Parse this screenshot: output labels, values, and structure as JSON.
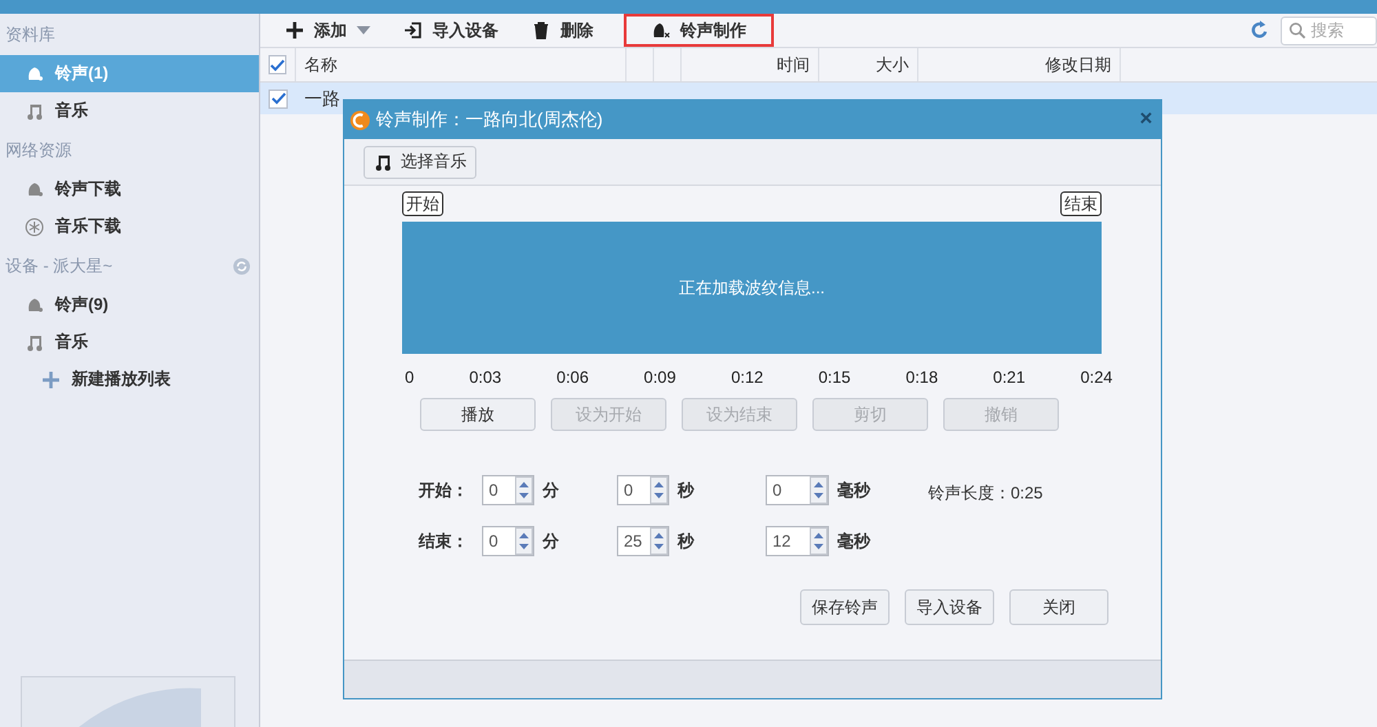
{
  "sidebar": {
    "sections": [
      {
        "title": "资料库",
        "kind": "library",
        "items": [
          {
            "label": "铃声(1)",
            "kind": "bell",
            "selected": true
          },
          {
            "label": "音乐",
            "kind": "note",
            "selected": false
          }
        ]
      },
      {
        "title": "网络资源",
        "kind": "library",
        "items": [
          {
            "label": "铃声下载",
            "kind": "bell",
            "selected": false
          },
          {
            "label": "音乐下载",
            "kind": "asterisk",
            "selected": false
          }
        ]
      },
      {
        "title": "设备 - 派大星~",
        "kind": "device",
        "items": [
          {
            "label": "铃声(9)",
            "kind": "bell",
            "selected": false
          },
          {
            "label": "音乐",
            "kind": "note",
            "selected": false
          },
          {
            "label": "新建播放列表",
            "kind": "plus",
            "selected": false
          }
        ]
      }
    ]
  },
  "toolbar": {
    "buttons": [
      {
        "label": "添加",
        "kind": "plus",
        "dropdown": true,
        "highlighted": false
      },
      {
        "label": "导入设备",
        "kind": "import",
        "dropdown": false,
        "highlighted": false
      },
      {
        "label": "删除",
        "kind": "trash",
        "dropdown": false,
        "highlighted": false
      },
      {
        "label": "铃声制作",
        "kind": "ringtone",
        "dropdown": false,
        "highlighted": true
      }
    ],
    "search": {
      "placeholder": "搜索"
    }
  },
  "table": {
    "all_checked": true,
    "columns": [
      {
        "label": "名称"
      },
      {
        "label": "时间"
      },
      {
        "label": "大小"
      },
      {
        "label": "修改日期"
      }
    ],
    "rows": [
      {
        "name": "一路",
        "checked": true,
        "selected": true
      }
    ]
  },
  "dialog": {
    "title": "铃声制作：一路向北(周杰伦)",
    "close": "×",
    "choose_button": "选择音乐",
    "start_marker": "开始",
    "end_marker": "结束",
    "wave_message": "正在加载波纹信息...",
    "ticks": [
      "0",
      "0:03",
      "0:06",
      "0:09",
      "0:12",
      "0:15",
      "0:18",
      "0:21",
      "0:24"
    ],
    "actions": [
      {
        "label": "播放",
        "disabled": false
      },
      {
        "label": "设为开始",
        "disabled": true
      },
      {
        "label": "设为结束",
        "disabled": true
      },
      {
        "label": "剪切",
        "disabled": true
      },
      {
        "label": "撤销",
        "disabled": true
      }
    ],
    "time_rows": [
      {
        "label": "开始：",
        "fields": [
          {
            "value": "0",
            "unit": "分"
          },
          {
            "value": "0",
            "unit": "秒"
          },
          {
            "value": "0",
            "unit": "毫秒"
          }
        ]
      },
      {
        "label": "结束：",
        "fields": [
          {
            "value": "0",
            "unit": "分"
          },
          {
            "value": "25",
            "unit": "秒"
          },
          {
            "value": "12",
            "unit": "毫秒"
          }
        ]
      }
    ],
    "length": "铃声长度：0:25",
    "buttons": [
      "保存铃声",
      "导入设备",
      "关闭"
    ]
  }
}
